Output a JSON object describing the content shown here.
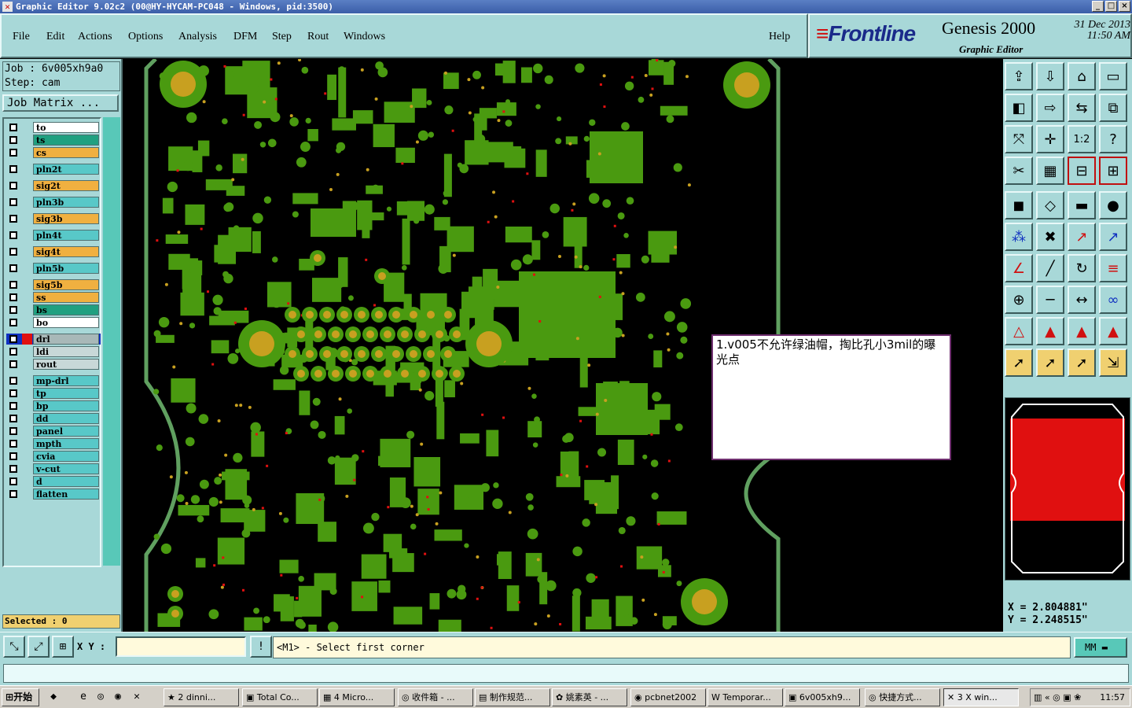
{
  "window": {
    "title": "Graphic Editor 9.02c2 (00@HY-HYCAM-PC048 - Windows, pid:3500)",
    "controls": [
      "_",
      "□",
      "×"
    ]
  },
  "menu": {
    "items": [
      "File",
      "Edit",
      "Actions",
      "Options",
      "Analysis",
      "DFM",
      "Step",
      "Rout",
      "Windows"
    ],
    "help": "Help"
  },
  "brand": {
    "logo": "Frontline",
    "product": "Genesis 2000",
    "subtitle": "Graphic Editor",
    "date": "31 Dec 2013",
    "time": "11:50 AM"
  },
  "job": {
    "job_line": "Job : 6v005xh9a0",
    "step_line": "Step: cam",
    "matrix_button": "Job Matrix ..."
  },
  "layers": [
    {
      "name": "to",
      "color": "#ffffff"
    },
    {
      "name": "ts",
      "color": "#20a080"
    },
    {
      "name": "cs",
      "color": "#f0b040"
    },
    {
      "name": "pln2t",
      "color": "#58c8c8"
    },
    {
      "name": "sig2t",
      "color": "#f0b040"
    },
    {
      "name": "pln3b",
      "color": "#58c8c8"
    },
    {
      "name": "sig3b",
      "color": "#f0b040"
    },
    {
      "name": "pln4t",
      "color": "#58c8c8"
    },
    {
      "name": "sig4t",
      "color": "#f0b040"
    },
    {
      "name": "pln5b",
      "color": "#58c8c8"
    },
    {
      "name": "sig5b",
      "color": "#f0b040"
    },
    {
      "name": "ss",
      "color": "#f0b040"
    },
    {
      "name": "bs",
      "color": "#20a080"
    },
    {
      "name": "bo",
      "color": "#ffffff"
    },
    {
      "name": "drl",
      "color": "#a8b8b8"
    },
    {
      "name": "ldi",
      "color": "#c8d8d8"
    },
    {
      "name": "rout",
      "color": "#c8d8d8"
    },
    {
      "name": "mp-drl",
      "color": "#58c8c8"
    },
    {
      "name": "tp",
      "color": "#58c8c8"
    },
    {
      "name": "bp",
      "color": "#58c8c8"
    },
    {
      "name": "dd",
      "color": "#58c8c8"
    },
    {
      "name": "panel",
      "color": "#58c8c8"
    },
    {
      "name": "mpth",
      "color": "#58c8c8"
    },
    {
      "name": "cvia",
      "color": "#58c8c8"
    },
    {
      "name": "v-cut",
      "color": "#58c8c8"
    },
    {
      "name": "d",
      "color": "#58c8c8"
    },
    {
      "name": "flatten",
      "color": "#58c8c8"
    }
  ],
  "selected": "Selected : 0",
  "note": {
    "text": "1.v005不允许绿油帽，掏比孔小3mil的曝光点"
  },
  "colors": {
    "board_green": "#4a9a10",
    "pad_gold": "#c8a020",
    "outline": "#60a060",
    "highlight_red": "#e01010",
    "panel_bg": "#a8d8d8"
  },
  "toolbar_icons": [
    "zoom-home-icon",
    "zoom-prev-icon",
    "home-icon",
    "window-icon",
    "pan-left-icon",
    "pan-right-icon",
    "swap-icon",
    "step-icon",
    "fit-icon",
    "center-icon",
    "ratio-label",
    "help-icon",
    "cut-icon",
    "grid-icon",
    "net-left-icon",
    "net-right-icon",
    "pad-select-icon",
    "polygon-icon",
    "ruler-icon",
    "dot-icon",
    "connect-icon",
    "cross-icon",
    "snap-icon",
    "snap-red-icon",
    "angle-icon",
    "line-icon",
    "arc-icon",
    "text-icon",
    "add-pad-icon",
    "minus-icon",
    "measure-icon",
    "circles-icon",
    "triangle-icon",
    "triangle-a-icon",
    "triangle-b-icon",
    "triangle-c-icon",
    "pointer-icon",
    "select-icon",
    "select-alt-icon",
    "route-icon"
  ],
  "ratio_label": "1:2",
  "coords": {
    "x": "X = 2.804881\"",
    "y": "Y = 2.248515\""
  },
  "cmd": {
    "xy_label": "X Y :",
    "xy_value": "",
    "message": "<M1> - Select first corner",
    "units": "MM"
  },
  "taskbar": {
    "start": "开始",
    "tasks": [
      "2 dinni...",
      "Total Co...",
      "4 Micro...",
      "收件箱 - ...",
      "制作规范...",
      "姚素英 - ...",
      "pcbnet2002",
      "Temporar...",
      "6v005xh9...",
      "快捷方式...",
      "3 X win..."
    ],
    "clock": "11:57"
  }
}
